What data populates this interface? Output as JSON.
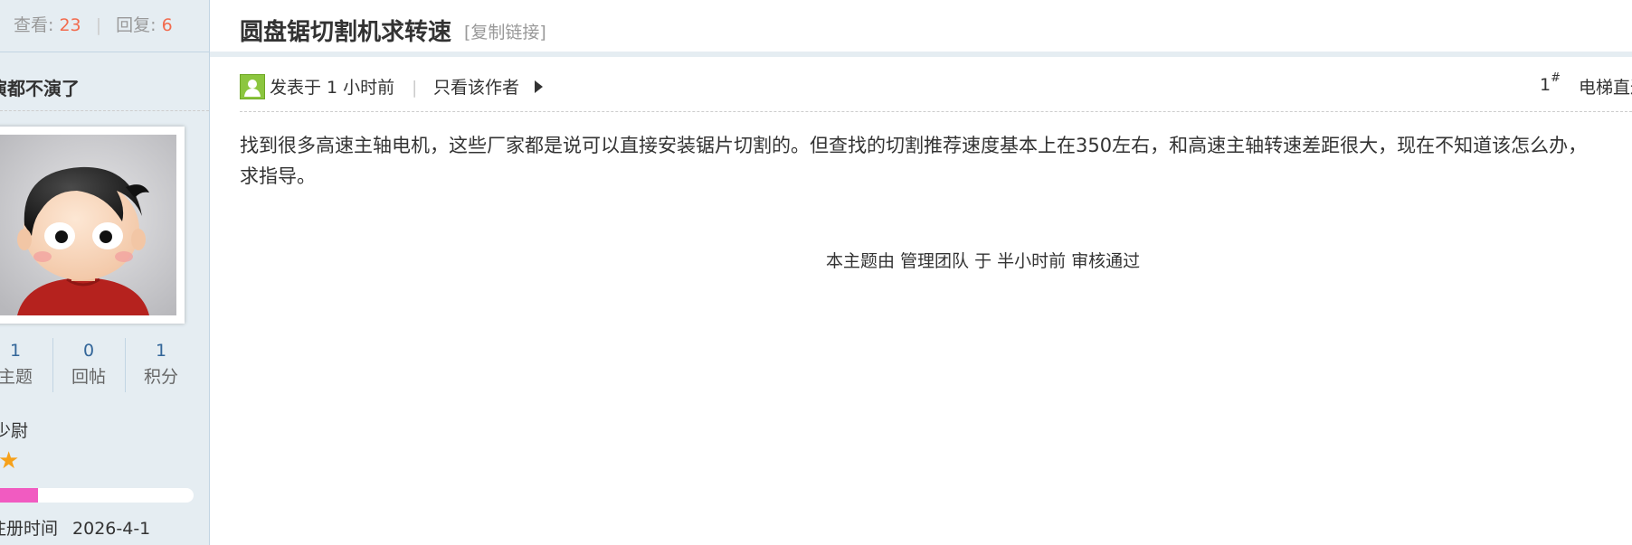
{
  "stats": {
    "views_label": "查看:",
    "views_value": "23",
    "separator": "|",
    "replies_label": "回复:",
    "replies_value": "6"
  },
  "author": {
    "name": "演都不演了",
    "stats": [
      {
        "value": "1",
        "label": "主题"
      },
      {
        "value": "0",
        "label": "回帖"
      },
      {
        "value": "1",
        "label": "积分"
      }
    ],
    "rank": "少尉",
    "rank_icon": "star-icon",
    "progress_percent": 23,
    "progress_color": "#f15bc1",
    "reg_label": "注册时间",
    "reg_value": "2026-4-1"
  },
  "thread": {
    "title": "圆盘锯切割机求转速",
    "copy_link": "[复制链接]"
  },
  "post": {
    "posted_time": "发表于 1 小时前",
    "meta_separator": "|",
    "only_author": "只看该作者",
    "floor": "1",
    "floor_mark": "#",
    "elevator": "电梯直达",
    "content_line1": "找到很多高速主轴电机，这些厂家都是说可以直接安装锯片切割的。但查找的切割推荐速度基本上在350左右，和高速主轴转速差距很大，现在不知道该怎么办，",
    "content_line2": "求指导。",
    "moderation": "本主题由 管理团队 于 半小时前 审核通过"
  },
  "colors": {
    "sidebar_bg": "#e5edf2",
    "count_accent": "#f26c4f",
    "stat_value": "#336699",
    "star": "#f6a11a"
  }
}
